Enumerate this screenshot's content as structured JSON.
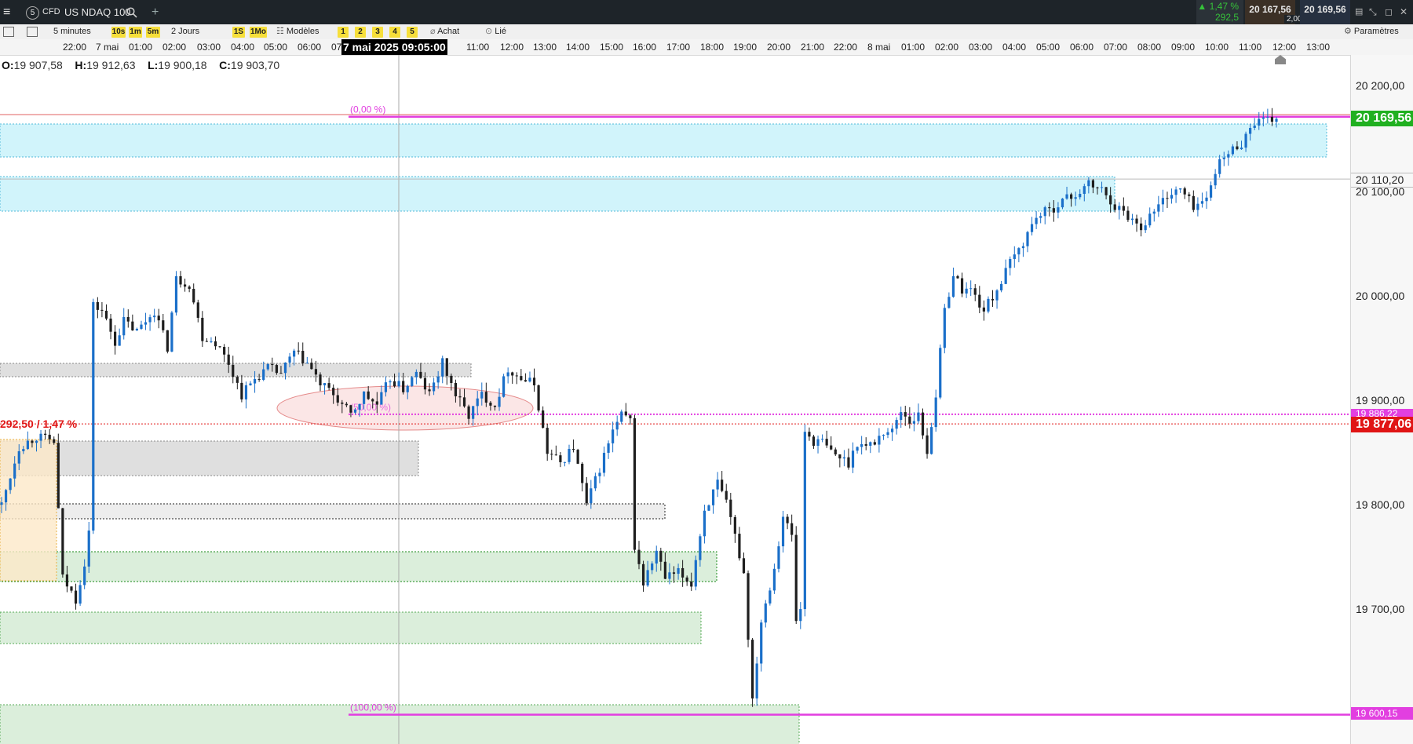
{
  "header": {
    "badge_number": "5",
    "instrument_type": "CFD",
    "instrument_name": "US NDAQ 100",
    "change_percent": "1,47 %",
    "change_points": "292,5",
    "bid": "20 167,56",
    "spread": "2,00",
    "ask": "20 169,56"
  },
  "toolbar": {
    "interval": "5 minutes",
    "timeframes": [
      "10s",
      "1m",
      "5m"
    ],
    "period": "2 Jours",
    "ranges": [
      "1S",
      "1Mo"
    ],
    "models": "Modèles",
    "layouts": [
      "1",
      "2",
      "3",
      "4",
      "5"
    ],
    "buy": "Achat",
    "linked": "Lié",
    "settings": "Paramètres"
  },
  "ohlc": {
    "o_label": "O:",
    "o": "19 907,58",
    "h_label": "H:",
    "h": "19 912,63",
    "l_label": "L:",
    "l": "19 900,18",
    "c_label": "C:",
    "c": "19 903,70"
  },
  "colors": {
    "up": "#1a6fc9",
    "down": "#1e1e1e",
    "fib": "#e23fe0",
    "last_price": "#20b020",
    "ref_price": "#e01515",
    "zone_blue": "#bdeffa",
    "zone_grey": "#d9d9d9",
    "zone_green": "#cfe8cf",
    "zone_orange": "#fde9c8",
    "bg": "#ffffff"
  },
  "chart_data": {
    "type": "candlestick",
    "instrument": "US NDAQ 100",
    "interval": "5 minutes",
    "x_ticks": [
      "22:00",
      "7 mai",
      "01:00",
      "02:00",
      "03:00",
      "04:00",
      "05:00",
      "06:00",
      "07",
      "7 mai 2025 09:05:00",
      "11:00",
      "12:00",
      "13:00",
      "14:00",
      "15:00",
      "16:00",
      "17:00",
      "18:00",
      "19:00",
      "20:00",
      "21:00",
      "22:00",
      "8 mai",
      "01:00",
      "02:00",
      "03:00",
      "04:00",
      "05:00",
      "06:00",
      "07:00",
      "08:00",
      "09:00",
      "10:00",
      "11:00",
      "12:00",
      "13:00"
    ],
    "y_ticks": [
      "20 200,00",
      "20 100,00",
      "20 000,00",
      "19 900,00",
      "19 800,00",
      "19 700,00"
    ],
    "ylim": [
      19590,
      20290
    ],
    "price_path": [
      [
        0,
        19800
      ],
      [
        4,
        19855
      ],
      [
        8,
        19865
      ],
      [
        12,
        19860
      ],
      [
        14,
        19730
      ],
      [
        17,
        19710
      ],
      [
        19,
        19745
      ],
      [
        20,
        19775
      ],
      [
        21,
        19990
      ],
      [
        23,
        19985
      ],
      [
        26,
        19955
      ],
      [
        28,
        19975
      ],
      [
        31,
        19965
      ],
      [
        35,
        19985
      ],
      [
        38,
        19950
      ],
      [
        40,
        20015
      ],
      [
        43,
        20010
      ],
      [
        46,
        19960
      ],
      [
        49,
        19955
      ],
      [
        52,
        19935
      ],
      [
        55,
        19905
      ],
      [
        58,
        19920
      ],
      [
        61,
        19930
      ],
      [
        64,
        19925
      ],
      [
        67,
        19945
      ],
      [
        70,
        19935
      ],
      [
        73,
        19915
      ],
      [
        76,
        19905
      ],
      [
        80,
        19885
      ],
      [
        83,
        19905
      ],
      [
        86,
        19895
      ],
      [
        89,
        19920
      ],
      [
        92,
        19910
      ],
      [
        95,
        19925
      ],
      [
        98,
        19905
      ],
      [
        101,
        19935
      ],
      [
        104,
        19905
      ],
      [
        107,
        19885
      ],
      [
        110,
        19905
      ],
      [
        113,
        19895
      ],
      [
        116,
        19930
      ],
      [
        119,
        19920
      ],
      [
        122,
        19915
      ],
      [
        125,
        19850
      ],
      [
        128,
        19840
      ],
      [
        131,
        19855
      ],
      [
        134,
        19800
      ],
      [
        137,
        19835
      ],
      [
        140,
        19870
      ],
      [
        142,
        19885
      ],
      [
        144,
        19880
      ],
      [
        145,
        19760
      ],
      [
        147,
        19725
      ],
      [
        150,
        19755
      ],
      [
        152,
        19730
      ],
      [
        155,
        19735
      ],
      [
        158,
        19725
      ],
      [
        161,
        19795
      ],
      [
        164,
        19820
      ],
      [
        166,
        19800
      ],
      [
        168,
        19770
      ],
      [
        170,
        19735
      ],
      [
        172,
        19615
      ],
      [
        174,
        19690
      ],
      [
        177,
        19740
      ],
      [
        179,
        19790
      ],
      [
        181,
        19770
      ],
      [
        182,
        19690
      ],
      [
        183,
        19700
      ],
      [
        184,
        19870
      ],
      [
        186,
        19860
      ],
      [
        188,
        19860
      ],
      [
        190,
        19850
      ],
      [
        192,
        19845
      ],
      [
        194,
        19840
      ],
      [
        196,
        19860
      ],
      [
        198,
        19855
      ],
      [
        200,
        19860
      ],
      [
        202,
        19870
      ],
      [
        204,
        19870
      ],
      [
        206,
        19890
      ],
      [
        208,
        19880
      ],
      [
        210,
        19885
      ],
      [
        212,
        19850
      ],
      [
        214,
        19905
      ],
      [
        216,
        19985
      ],
      [
        218,
        20020
      ],
      [
        220,
        20005
      ],
      [
        222,
        20005
      ],
      [
        225,
        19985
      ],
      [
        228,
        20005
      ],
      [
        231,
        20030
      ],
      [
        234,
        20050
      ],
      [
        237,
        20075
      ],
      [
        240,
        20080
      ],
      [
        243,
        20090
      ],
      [
        246,
        20095
      ],
      [
        249,
        20105
      ],
      [
        252,
        20100
      ],
      [
        255,
        20085
      ],
      [
        258,
        20075
      ],
      [
        261,
        20065
      ],
      [
        264,
        20080
      ],
      [
        267,
        20095
      ],
      [
        270,
        20100
      ],
      [
        273,
        20085
      ],
      [
        276,
        20090
      ],
      [
        278,
        20120
      ],
      [
        281,
        20135
      ],
      [
        284,
        20145
      ],
      [
        287,
        20165
      ],
      [
        290,
        20165
      ],
      [
        292,
        20168
      ]
    ],
    "annotations": {
      "fib_top_price": 20169.56,
      "fib_top_label": "(0,00 %)",
      "fib_mid_price": 19886.22,
      "fib_mid_label": "(50,00 %)",
      "fib_bottom_price": 19600.15,
      "fib_bottom_label": "(100,00 %)",
      "ref_price": 19877.06,
      "ref_label": "292,50 / 1,47 %",
      "last_price": 20169.56,
      "crosshair_price": 20110.2
    },
    "price_tags": [
      "20 169,56",
      "20 110,20",
      "19 886,22",
      "19 877,06",
      "19 600,15"
    ]
  }
}
